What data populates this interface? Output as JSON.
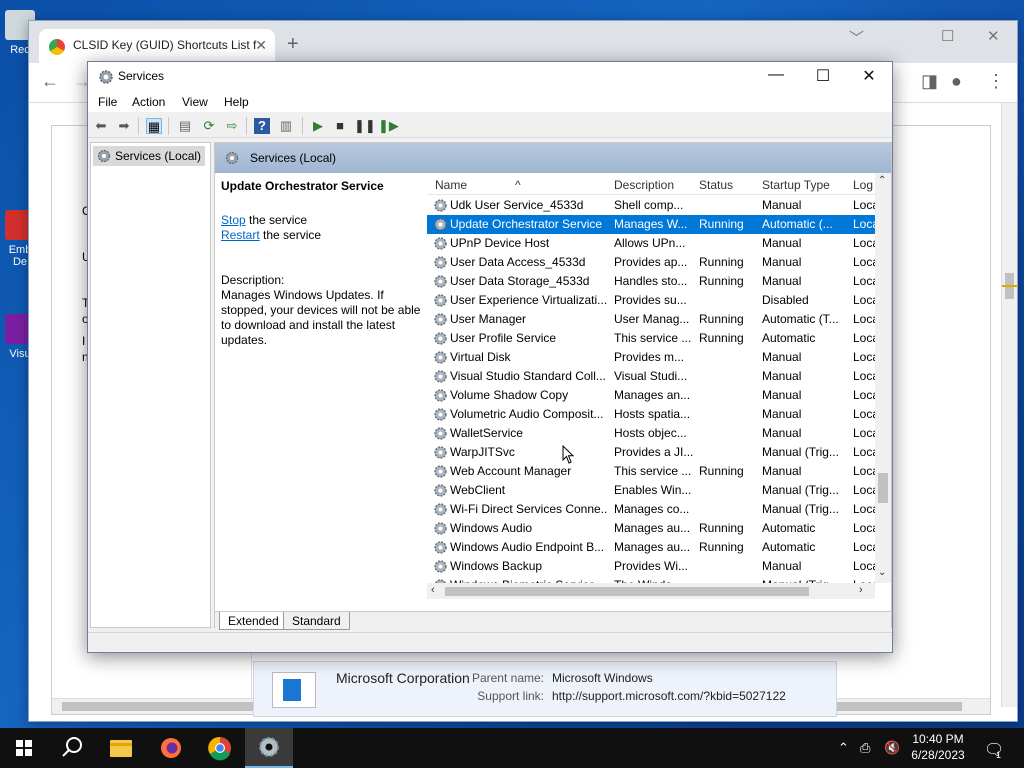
{
  "desktop": {
    "icons": [
      {
        "label": "Rec",
        "color": "#cfd8dc"
      },
      {
        "label": "Emb\nDe",
        "color": "#d32f2f"
      },
      {
        "label": "Visu",
        "color": "#7b1fa2"
      }
    ]
  },
  "chrome": {
    "tab_title": "CLSID Key (GUID) Shortcuts List f",
    "close_tab": "✕",
    "new_tab": "+",
    "min": "﹀",
    "max": "☐",
    "close": "✕",
    "page_left_text": [
      "C",
      "U",
      "T",
      "o",
      "I",
      "n"
    ],
    "info": {
      "company": "Microsoft Corporation",
      "parent_label": "Parent name:",
      "parent_value": "Microsoft Windows",
      "support_label": "Support link:",
      "support_value": "http://support.microsoft.com/?kbid=5027122"
    }
  },
  "services": {
    "title": "Services",
    "menu": [
      "File",
      "Action",
      "View",
      "Help"
    ],
    "tree_node": "Services (Local)",
    "header_title": "Services (Local)",
    "selected_title": "Update Orchestrator Service",
    "stop_link": "Stop",
    "stop_rest": " the service",
    "restart_link": "Restart",
    "restart_rest": " the service",
    "description_label": "Description:",
    "description": "Manages Windows Updates. If stopped, your devices will not be able to download and install the latest updates.",
    "columns": {
      "name": "Name",
      "description": "Description",
      "status": "Status",
      "startup": "Startup Type",
      "logon": "Log"
    },
    "rows": [
      {
        "name": "Udk User Service_4533d",
        "desc": "Shell comp...",
        "status": "",
        "startup": "Manual",
        "logon": "Loca"
      },
      {
        "name": "Update Orchestrator Service",
        "desc": "Manages W...",
        "status": "Running",
        "startup": "Automatic (...",
        "logon": "Loca",
        "selected": true
      },
      {
        "name": "UPnP Device Host",
        "desc": "Allows UPn...",
        "status": "",
        "startup": "Manual",
        "logon": "Loca"
      },
      {
        "name": "User Data Access_4533d",
        "desc": "Provides ap...",
        "status": "Running",
        "startup": "Manual",
        "logon": "Loca"
      },
      {
        "name": "User Data Storage_4533d",
        "desc": "Handles sto...",
        "status": "Running",
        "startup": "Manual",
        "logon": "Loca"
      },
      {
        "name": "User Experience Virtualizati...",
        "desc": "Provides su...",
        "status": "",
        "startup": "Disabled",
        "logon": "Loca"
      },
      {
        "name": "User Manager",
        "desc": "User Manag...",
        "status": "Running",
        "startup": "Automatic (T...",
        "logon": "Loca"
      },
      {
        "name": "User Profile Service",
        "desc": "This service ...",
        "status": "Running",
        "startup": "Automatic",
        "logon": "Loca"
      },
      {
        "name": "Virtual Disk",
        "desc": "Provides m...",
        "status": "",
        "startup": "Manual",
        "logon": "Loca"
      },
      {
        "name": "Visual Studio Standard Coll...",
        "desc": "Visual Studi...",
        "status": "",
        "startup": "Manual",
        "logon": "Loca"
      },
      {
        "name": "Volume Shadow Copy",
        "desc": "Manages an...",
        "status": "",
        "startup": "Manual",
        "logon": "Loca"
      },
      {
        "name": "Volumetric Audio Composit...",
        "desc": "Hosts spatia...",
        "status": "",
        "startup": "Manual",
        "logon": "Loca"
      },
      {
        "name": "WalletService",
        "desc": "Hosts objec...",
        "status": "",
        "startup": "Manual",
        "logon": "Loca"
      },
      {
        "name": "WarpJITSvc",
        "desc": "Provides a JI...",
        "status": "",
        "startup": "Manual (Trig...",
        "logon": "Loca"
      },
      {
        "name": "Web Account Manager",
        "desc": "This service ...",
        "status": "Running",
        "startup": "Manual",
        "logon": "Loca"
      },
      {
        "name": "WebClient",
        "desc": "Enables Win...",
        "status": "",
        "startup": "Manual (Trig...",
        "logon": "Loca"
      },
      {
        "name": "Wi-Fi Direct Services Conne...",
        "desc": "Manages co...",
        "status": "",
        "startup": "Manual (Trig...",
        "logon": "Loca"
      },
      {
        "name": "Windows Audio",
        "desc": "Manages au...",
        "status": "Running",
        "startup": "Automatic",
        "logon": "Loca"
      },
      {
        "name": "Windows Audio Endpoint B...",
        "desc": "Manages au...",
        "status": "Running",
        "startup": "Automatic",
        "logon": "Loca"
      },
      {
        "name": "Windows Backup",
        "desc": "Provides Wi...",
        "status": "",
        "startup": "Manual",
        "logon": "Loca"
      },
      {
        "name": "Windows Biometric Service",
        "desc": "The Windo...",
        "status": "",
        "startup": "Manual (Trig...",
        "logon": "Loca"
      }
    ],
    "tabs": [
      "Extended",
      "Standard"
    ]
  },
  "taskbar": {
    "time": "10:40 PM",
    "date": "6/28/2023",
    "notification_count": "1",
    "apps": [
      "start-icon",
      "search-icon",
      "file-explorer-icon",
      "firefox-icon",
      "chrome-icon",
      "services-icon"
    ]
  },
  "colors": {
    "selection": "#0078d7",
    "link": "#0066cc",
    "taskbar": "#101010",
    "desktop": "#1565c0"
  }
}
